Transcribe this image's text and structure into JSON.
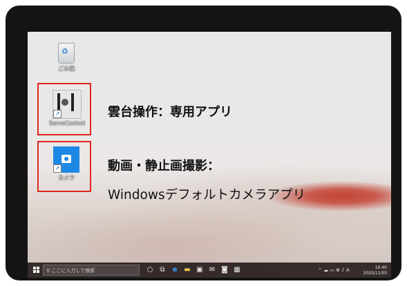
{
  "desktop": {
    "icons": [
      {
        "label": "ごみ箱",
        "icon": "recycle-bin-icon"
      },
      {
        "label": "ServoControl",
        "icon": "servo-control-app-icon"
      },
      {
        "label": "カメラ",
        "icon": "camera-app-icon"
      }
    ]
  },
  "annotations": {
    "caption1": "雲台操作：専用アプリ",
    "caption2": "動画・静止画撮影：",
    "caption3": "Windowsデフォルトカメラアプリ",
    "highlight_color": "#e0261b"
  },
  "taskbar": {
    "search_placeholder": "ここに入力して検索",
    "apps": [
      "task-view-icon",
      "edge-icon",
      "file-explorer-icon",
      "store-icon",
      "mail-icon",
      "camera-icon",
      "photos-icon"
    ],
    "tray_language": "A",
    "time": "16:40",
    "date": "2020/11/03"
  }
}
